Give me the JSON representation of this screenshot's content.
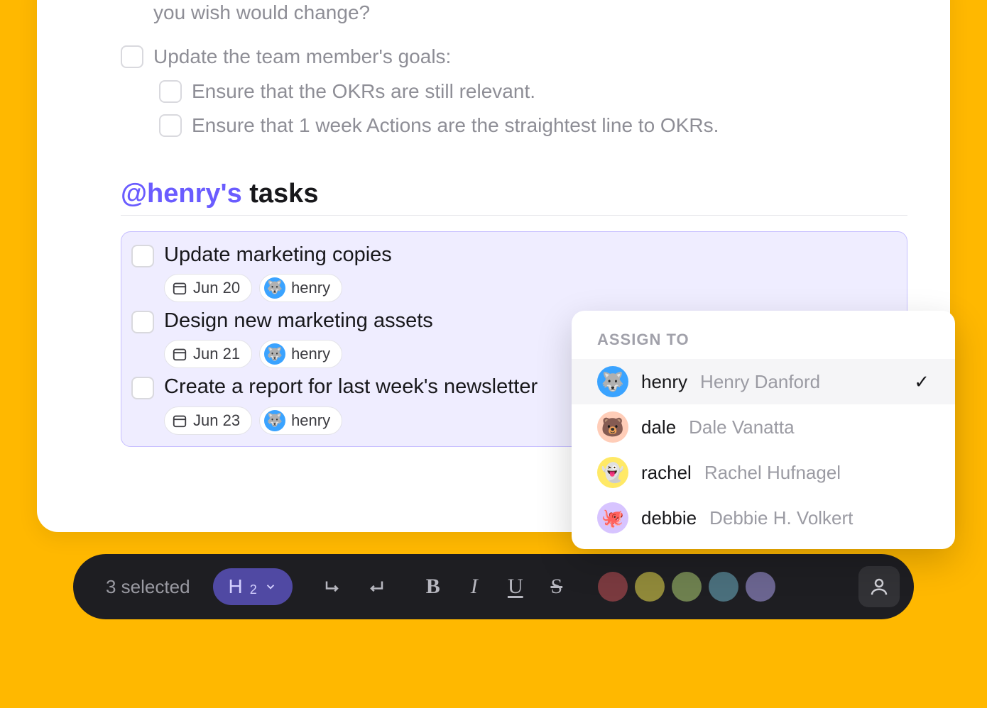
{
  "doc": {
    "prev_line": "you wish would change?",
    "items": [
      {
        "label": "Update the team member's goals:",
        "indent": false
      },
      {
        "label": "Ensure that the OKRs are still relevant.",
        "indent": true
      },
      {
        "label": "Ensure that 1 week Actions are the straightest line to OKRs.",
        "indent": true
      }
    ],
    "heading_mention": "@henry's",
    "heading_rest": " tasks"
  },
  "tasks": [
    {
      "title": "Update marketing copies",
      "date": "Jun 20",
      "assignee": "henry"
    },
    {
      "title": "Design new marketing assets",
      "date": "Jun 21",
      "assignee": "henry"
    },
    {
      "title": "Create a report for last week's newsletter",
      "date": "Jun 23",
      "assignee": "henry"
    }
  ],
  "popover": {
    "title": "Assign to",
    "people": [
      {
        "username": "henry",
        "fullname": "Henry Danford",
        "emoji": "🐺",
        "avatar": "blue",
        "selected": true
      },
      {
        "username": "dale",
        "fullname": "Dale Vanatta",
        "emoji": "🐻",
        "avatar": "peach",
        "selected": false
      },
      {
        "username": "rachel",
        "fullname": "Rachel Hufnagel",
        "emoji": "👻",
        "avatar": "yellow",
        "selected": false
      },
      {
        "username": "debbie",
        "fullname": "Debbie H. Volkert",
        "emoji": "🐙",
        "avatar": "lilac",
        "selected": false
      }
    ]
  },
  "toolbar": {
    "selection": "3 selected",
    "heading_label": "H",
    "heading_level": "2",
    "buttons": {
      "bold": "B",
      "italic": "I",
      "underline": "U",
      "strike": "S"
    },
    "colors": [
      "red",
      "olive",
      "green",
      "teal",
      "purple"
    ]
  }
}
